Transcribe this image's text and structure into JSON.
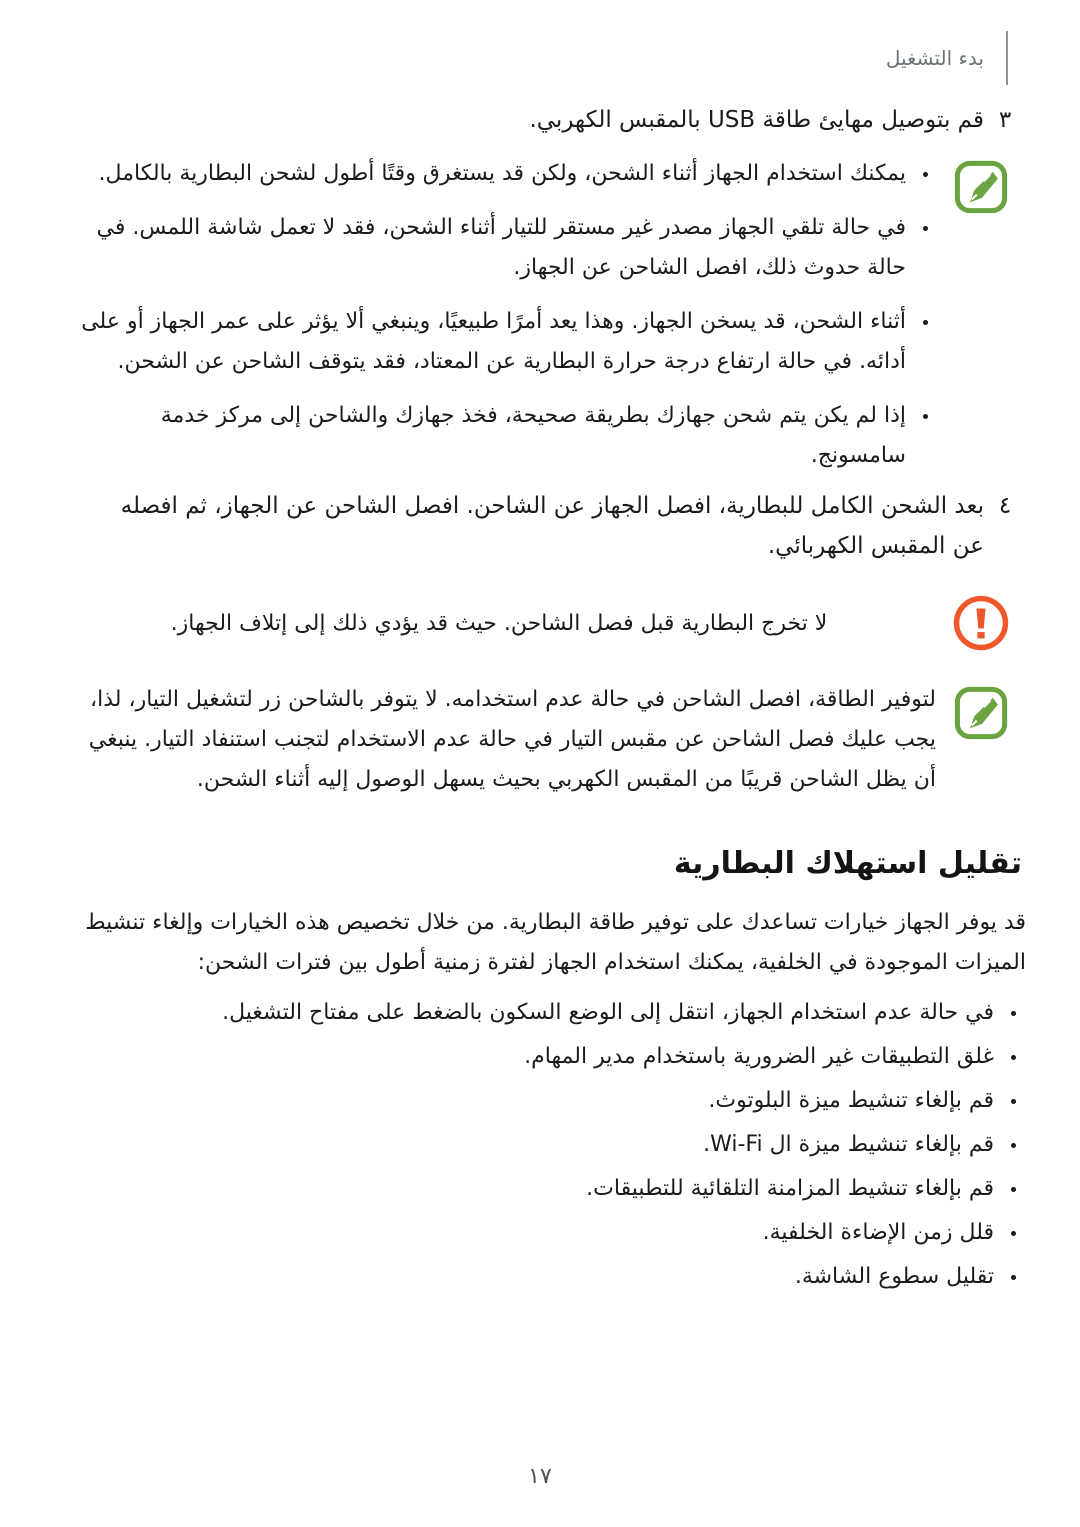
{
  "header": {
    "title": "بدء التشغيل",
    "rule_color": "#8d9499"
  },
  "colors": {
    "note_green": "#6aa340",
    "warning_orange": "#f0582a",
    "text": "#1b1b1b",
    "header_text": "#6d7478"
  },
  "steps": [
    {
      "number": "٣",
      "text": "قم بتوصيل مهايئ طاقة USB بالمقبس الكهربي."
    },
    {
      "number": "٤",
      "text": "بعد الشحن الكامل للبطارية، افصل الجهاز عن الشاحن. افصل الشاحن عن الجهاز، ثم افصله عن المقبس الكهربائي."
    }
  ],
  "note_one": {
    "icon": "note-pencil-icon",
    "items": [
      "يمكنك استخدام الجهاز أثناء الشحن، ولكن قد يستغرق وقتًا أطول لشحن البطارية بالكامل.",
      "في حالة تلقي الجهاز مصدر غير مستقر للتيار أثناء الشحن، فقد لا تعمل شاشة اللمس. في حالة حدوث ذلك، افصل الشاحن عن الجهاز.",
      "أثناء الشحن، قد يسخن الجهاز. وهذا يعد أمرًا طبيعيًا، وينبغي ألا يؤثر على عمر الجهاز أو على أدائه. في حالة ارتفاع درجة حرارة البطارية عن المعتاد، فقد يتوقف الشاحن عن الشحن.",
      "إذا لم يكن يتم شحن جهازك بطريقة صحيحة، فخذ جهازك والشاحن إلى مركز خدمة سامسونج."
    ]
  },
  "warning": {
    "icon": "warning-exclamation-icon",
    "text": "لا تخرج البطارية قبل فصل الشاحن. حيث قد يؤدي ذلك إلى إتلاف الجهاز."
  },
  "note_two": {
    "icon": "note-pencil-icon",
    "text": "لتوفير الطاقة، افصل الشاحن في حالة عدم استخدامه. لا يتوفر بالشاحن زر لتشغيل التيار، لذا، يجب عليك فصل الشاحن عن مقبس التيار في حالة عدم الاستخدام لتجنب استنفاد التيار. ينبغي أن يظل الشاحن قريبًا من المقبس الكهربي بحيث يسهل الوصول إليه أثناء الشحن."
  },
  "section": {
    "heading": "تقليل استهلاك البطارية",
    "intro": "قد يوفر الجهاز خيارات تساعدك على توفير طاقة البطارية. من خلال تخصيص هذه الخيارات وإلغاء تنشيط الميزات الموجودة في الخلفية، يمكنك استخدام الجهاز لفترة زمنية أطول بين فترات الشحن:",
    "tips": [
      "في حالة عدم استخدام الجهاز، انتقل إلى الوضع السكون بالضغط على مفتاح التشغيل.",
      "غلق التطبيقات غير الضرورية باستخدام مدير المهام.",
      "قم بإلغاء تنشيط ميزة البلوتوث.",
      "قم بإلغاء تنشيط ميزة ال Wi-Fi.",
      "قم بإلغاء تنشيط المزامنة التلقائية للتطبيقات.",
      "قلل زمن الإضاءة الخلفية.",
      "تقليل سطوع الشاشة."
    ]
  },
  "page_number": "١٧"
}
